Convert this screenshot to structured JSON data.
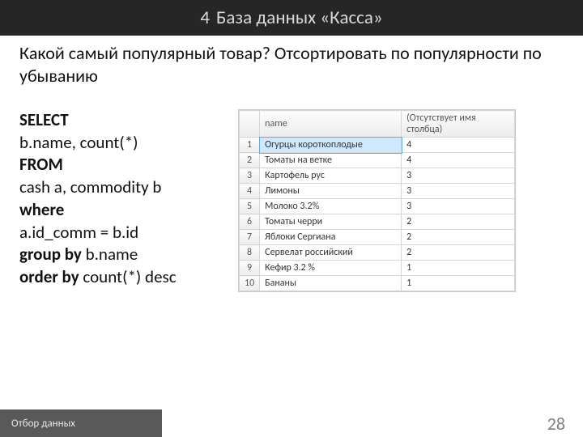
{
  "header": {
    "num": "4",
    "title": "База данных «Касса»"
  },
  "question": "Какой самый популярный товар? Отсортировать по популярности по убыванию",
  "sql": {
    "l1": "SELECT",
    "l2": "b.name, count(*)",
    "l3": "FROM",
    "l4": "cash a, commodity b",
    "l5": "where",
    "l6": "a.id_comm = b.id",
    "l7a": "group by",
    "l7b": " b.name",
    "l8a": "order by",
    "l8b": " count(*) desc"
  },
  "table": {
    "columns": [
      "name",
      "(Отсутствует имя столбца)"
    ],
    "rows": [
      {
        "n": "1",
        "name": "Огурцы короткоплодые",
        "cnt": "4"
      },
      {
        "n": "2",
        "name": "Томаты на ветке",
        "cnt": "4"
      },
      {
        "n": "3",
        "name": "Картофель рус",
        "cnt": "3"
      },
      {
        "n": "4",
        "name": "Лимоны",
        "cnt": "3"
      },
      {
        "n": "5",
        "name": "Молоко 3.2%",
        "cnt": "3"
      },
      {
        "n": "6",
        "name": "Томаты черри",
        "cnt": "2"
      },
      {
        "n": "7",
        "name": "Яблоки Сергиана",
        "cnt": "2"
      },
      {
        "n": "8",
        "name": "Сервелат российский",
        "cnt": "2"
      },
      {
        "n": "9",
        "name": "Кефир 3.2 %",
        "cnt": "1"
      },
      {
        "n": "10",
        "name": "Бананы",
        "cnt": "1"
      }
    ]
  },
  "footer": {
    "tab": "Отбор данных",
    "page": "28"
  }
}
